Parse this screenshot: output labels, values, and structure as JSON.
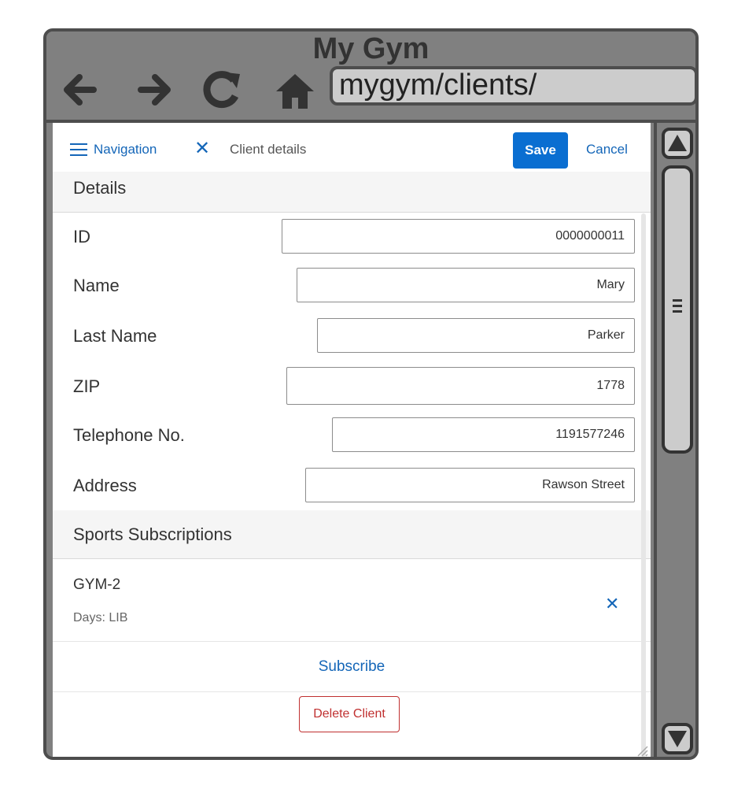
{
  "window": {
    "title": "My Gym",
    "url": "mygym/clients/"
  },
  "browser_icons": [
    "back-arrow-icon",
    "forward-arrow-icon",
    "reload-icon",
    "home-icon"
  ],
  "header": {
    "nav_label": "Navigation",
    "page_title": "Client details",
    "save_label": "Save",
    "cancel_label": "Cancel"
  },
  "details": {
    "section_title": "Details",
    "fields": [
      {
        "label": "ID",
        "value": "0000000011"
      },
      {
        "label": "Name",
        "value": "Mary"
      },
      {
        "label": "Last Name",
        "value": "Parker"
      },
      {
        "label": "ZIP",
        "value": "1778"
      },
      {
        "label": "Telephone No.",
        "value": "1191577246"
      },
      {
        "label": "Address",
        "value": "Rawson Street"
      }
    ]
  },
  "subscriptions": {
    "section_title": "Sports Subscriptions",
    "items": [
      {
        "title": "GYM-2",
        "days": "Days: LIB"
      }
    ],
    "subscribe_label": "Subscribe"
  },
  "actions": {
    "delete_label": "Delete Client"
  },
  "colors": {
    "accent": "#0a6ed1",
    "link": "#1466b8",
    "danger": "#c03030",
    "chrome": "#808080"
  }
}
